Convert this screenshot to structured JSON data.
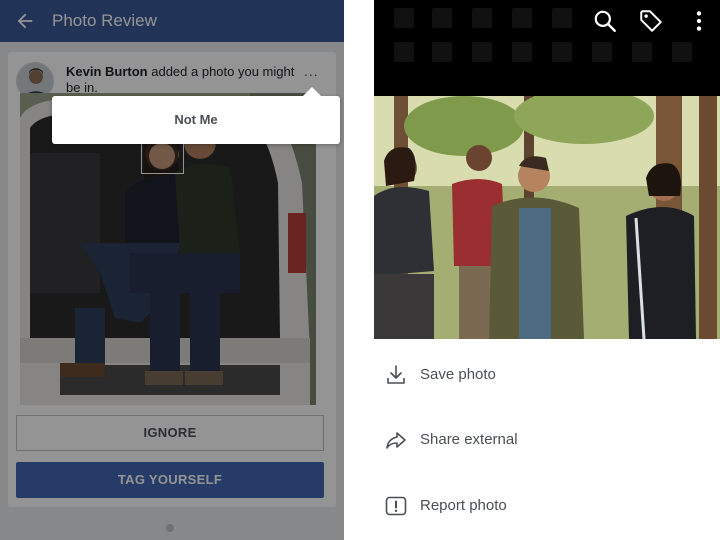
{
  "left_panel": {
    "appbar": {
      "title": "Photo Review",
      "back_icon": "arrow-left-icon"
    },
    "notification": {
      "actor": "Kevin Burton",
      "message": " added a photo you might be in.",
      "more_label": "..."
    },
    "popover": {
      "label": "Not Me"
    },
    "buttons": {
      "ignore": "IGNORE",
      "tag_yourself": "TAG YOURSELF"
    }
  },
  "right_panel": {
    "toolbar_icons": [
      "search-icon",
      "tag-icon",
      "more-vertical-icon"
    ],
    "menu": [
      {
        "label": "Save photo",
        "icon": "download-icon"
      },
      {
        "label": "Share external",
        "icon": "share-arrow-icon"
      },
      {
        "label": "Report photo",
        "icon": "report-icon"
      }
    ]
  },
  "colors": {
    "brand_blue": "#3b5998",
    "button_blue": "#4267b2",
    "overlay": "rgba(0,0,0,0.42)"
  }
}
